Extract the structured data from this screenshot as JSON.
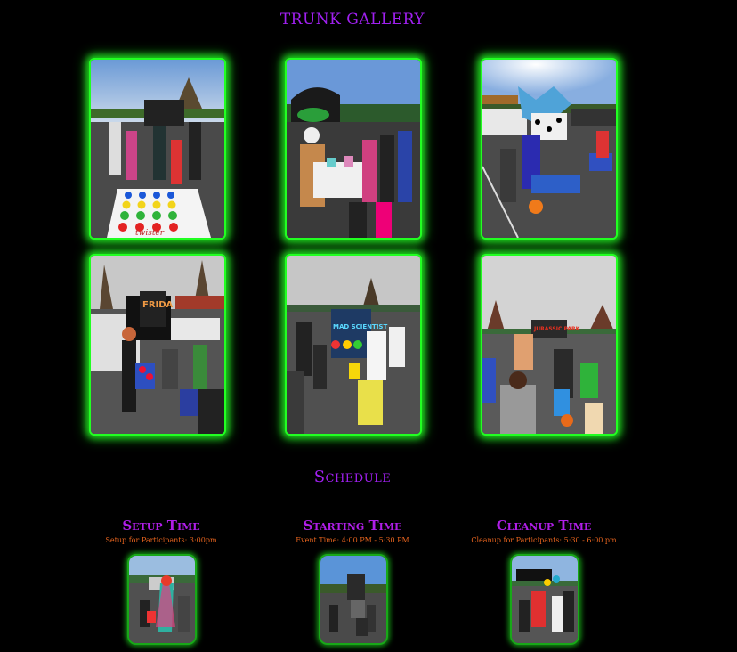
{
  "gallery": {
    "title": "TRUNK GALLERY",
    "photos": [
      {
        "name": "twister-trunk-photo"
      },
      {
        "name": "science-table-trunk-photo"
      },
      {
        "name": "dalmatian-trunk-photo"
      },
      {
        "name": "frida-trunk-photo"
      },
      {
        "name": "mad-scientist-trunk-photo"
      },
      {
        "name": "jurassic-park-trunk-photo"
      }
    ],
    "signs": {
      "twister": "twister",
      "frida": "FRIDA",
      "mad": "MAD SCIENTIST",
      "jurassic": "JURASSIC PARK"
    }
  },
  "schedule": {
    "title": "Schedule",
    "items": [
      {
        "title": "Setup Time",
        "detail": "Setup for Participants: 3:00pm"
      },
      {
        "title": "Starting Time",
        "detail": "Event Time: 4:00 PM - 5:30 PM"
      },
      {
        "title": "Cleanup Time",
        "detail": "Cleanup for Participants: 5:30 - 6:00 pm"
      }
    ]
  },
  "colors": {
    "heading": "#a020f0",
    "subtext": "#e8641e",
    "frame_glow": "#22ff22",
    "background": "#000000"
  }
}
